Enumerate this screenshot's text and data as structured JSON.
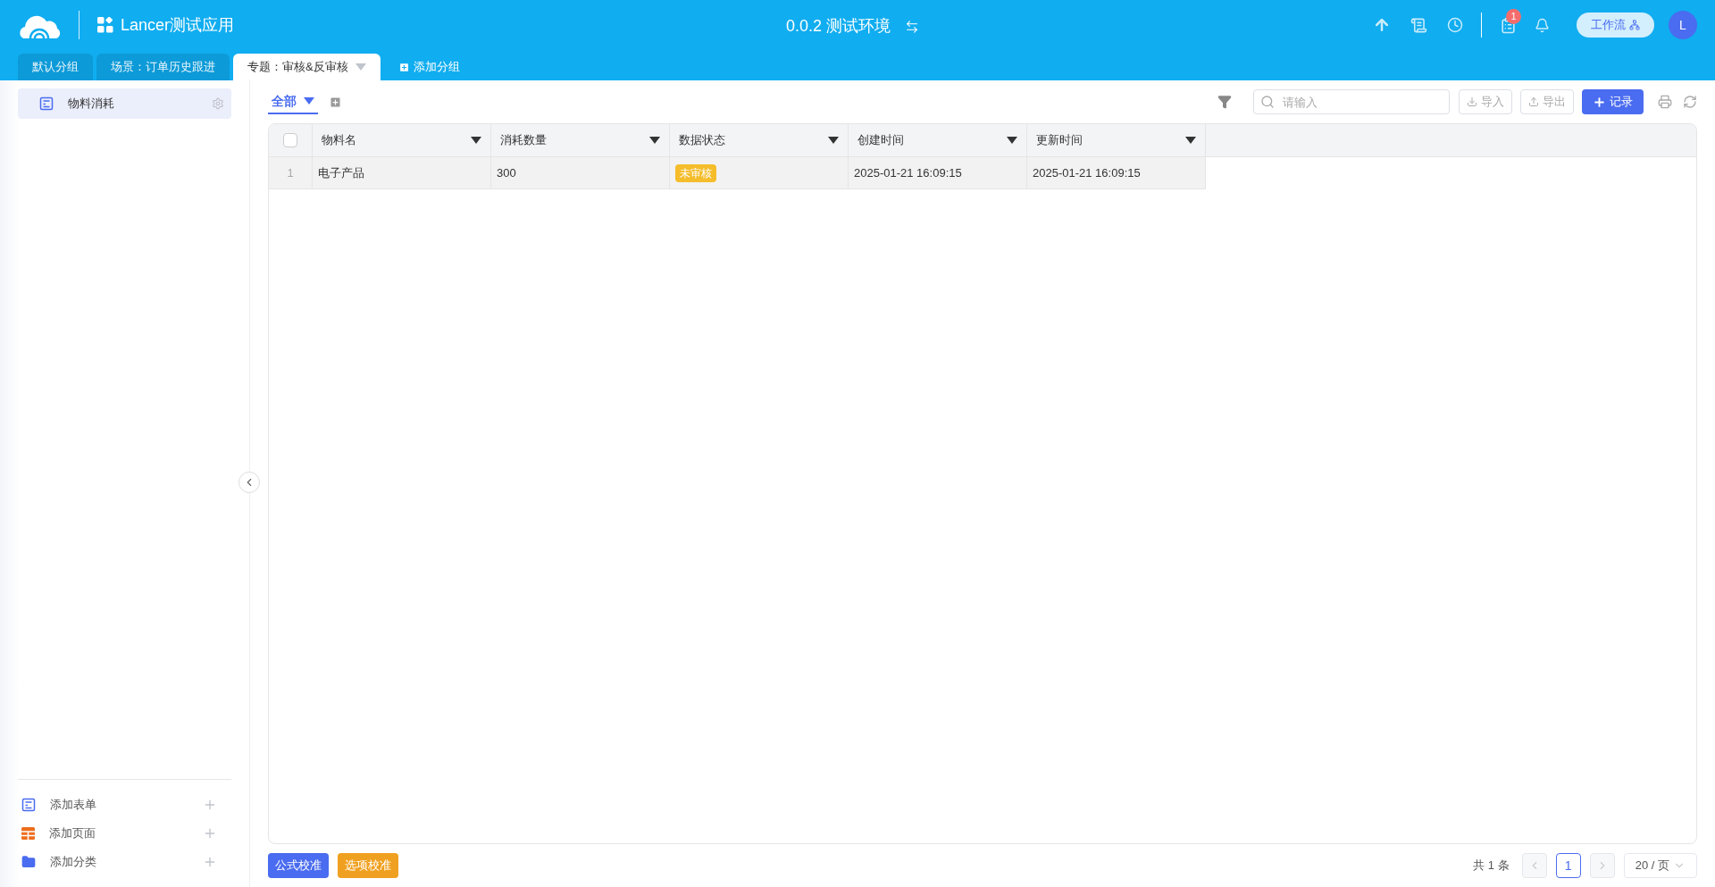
{
  "app": {
    "name": "Lancer测试应用"
  },
  "environment": {
    "label": "0.0.2 测试环境"
  },
  "notifications": {
    "badge": "1"
  },
  "workflow_button": {
    "label": "工作流"
  },
  "avatar": {
    "initial": "L"
  },
  "group_tabs": [
    {
      "label": "默认分组",
      "selected": false
    },
    {
      "label": "场景：订单历史跟进",
      "selected": false
    },
    {
      "label": "专题：审核&反审核",
      "selected": true
    }
  ],
  "add_group": {
    "label": "添加分组"
  },
  "sidebar": {
    "items": [
      {
        "label": "物料消耗",
        "selected": true
      }
    ],
    "actions": [
      {
        "label": "添加表单",
        "kind": "form"
      },
      {
        "label": "添加页面",
        "kind": "page"
      },
      {
        "label": "添加分类",
        "kind": "folder"
      }
    ]
  },
  "view_tabs": [
    {
      "label": "全部",
      "selected": true
    }
  ],
  "search": {
    "placeholder": "请输入"
  },
  "toolbar": {
    "import": "导入",
    "export": "导出",
    "add_record": "记录"
  },
  "table": {
    "select_all": {
      "checked": false
    },
    "columns": [
      "物料名",
      "消耗数量",
      "数据状态",
      "创建时间",
      "更新时间"
    ],
    "rows": [
      {
        "index": "1",
        "cells": [
          {
            "text": "电子产品",
            "kind": "text"
          },
          {
            "text": "300",
            "kind": "text"
          },
          {
            "text": "未审核",
            "kind": "tag"
          },
          {
            "text": "2025-01-21 16:09:15",
            "kind": "text"
          },
          {
            "text": "2025-01-21 16:09:15",
            "kind": "text"
          }
        ]
      }
    ]
  },
  "footer": {
    "buttons": [
      {
        "label": "公式校准",
        "kind": "primary"
      },
      {
        "label": "选项校准",
        "kind": "warning"
      }
    ]
  },
  "pagination": {
    "total": "共 1 条",
    "pages": [
      {
        "label": "1",
        "selected": true
      }
    ],
    "page_size": "20 / 页"
  }
}
